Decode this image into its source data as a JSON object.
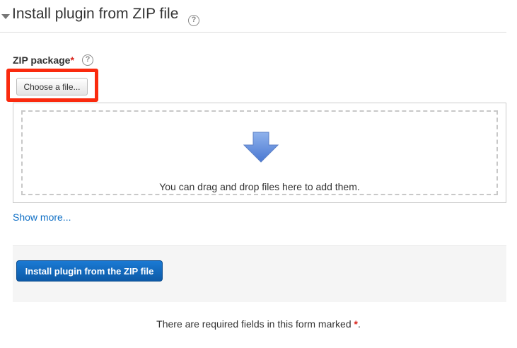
{
  "section": {
    "title": "Install plugin from ZIP file",
    "collapse_icon": "triangle-down-icon",
    "help_glyph": "?"
  },
  "zip_field": {
    "label": "ZIP package",
    "required_marker": "*",
    "help_glyph": "?",
    "choose_button_label": "Choose a file...",
    "highlight_color": "#fa2a0e"
  },
  "dropzone": {
    "icon": "down-arrow-icon",
    "text": "You can drag and drop files here to add them."
  },
  "show_more_link": "Show more...",
  "actions": {
    "install_button_label": "Install plugin from the ZIP file"
  },
  "required_note": {
    "prefix": "There are required fields in this form marked ",
    "marker": "*",
    "suffix": "."
  },
  "colors": {
    "link": "#0f6fc5",
    "primary_button": "#1a7ad4",
    "required": "#d9251d"
  }
}
